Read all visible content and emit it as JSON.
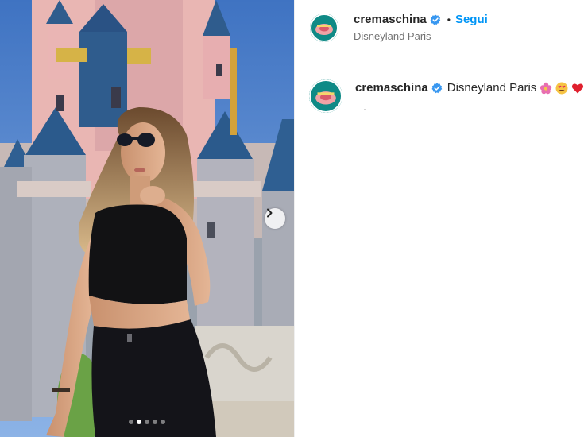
{
  "post": {
    "username": "cremaschina",
    "verified": true,
    "separator": "•",
    "follow_label": "Segui",
    "location": "Disneyland Paris",
    "caption_text": "Disneyland Paris",
    "caption_emojis": [
      "flower-emoji",
      "heart-eyes-emoji",
      "red-heart-emoji"
    ]
  },
  "carousel": {
    "slide_count": 5,
    "active_index": 1,
    "next_icon": "chevron-right-icon"
  },
  "colors": {
    "link_blue": "#0095f6",
    "verified_blue": "#3897f0",
    "avatar_teal": "#0f8a86",
    "text_dark": "#262626",
    "text_muted": "#737373"
  }
}
